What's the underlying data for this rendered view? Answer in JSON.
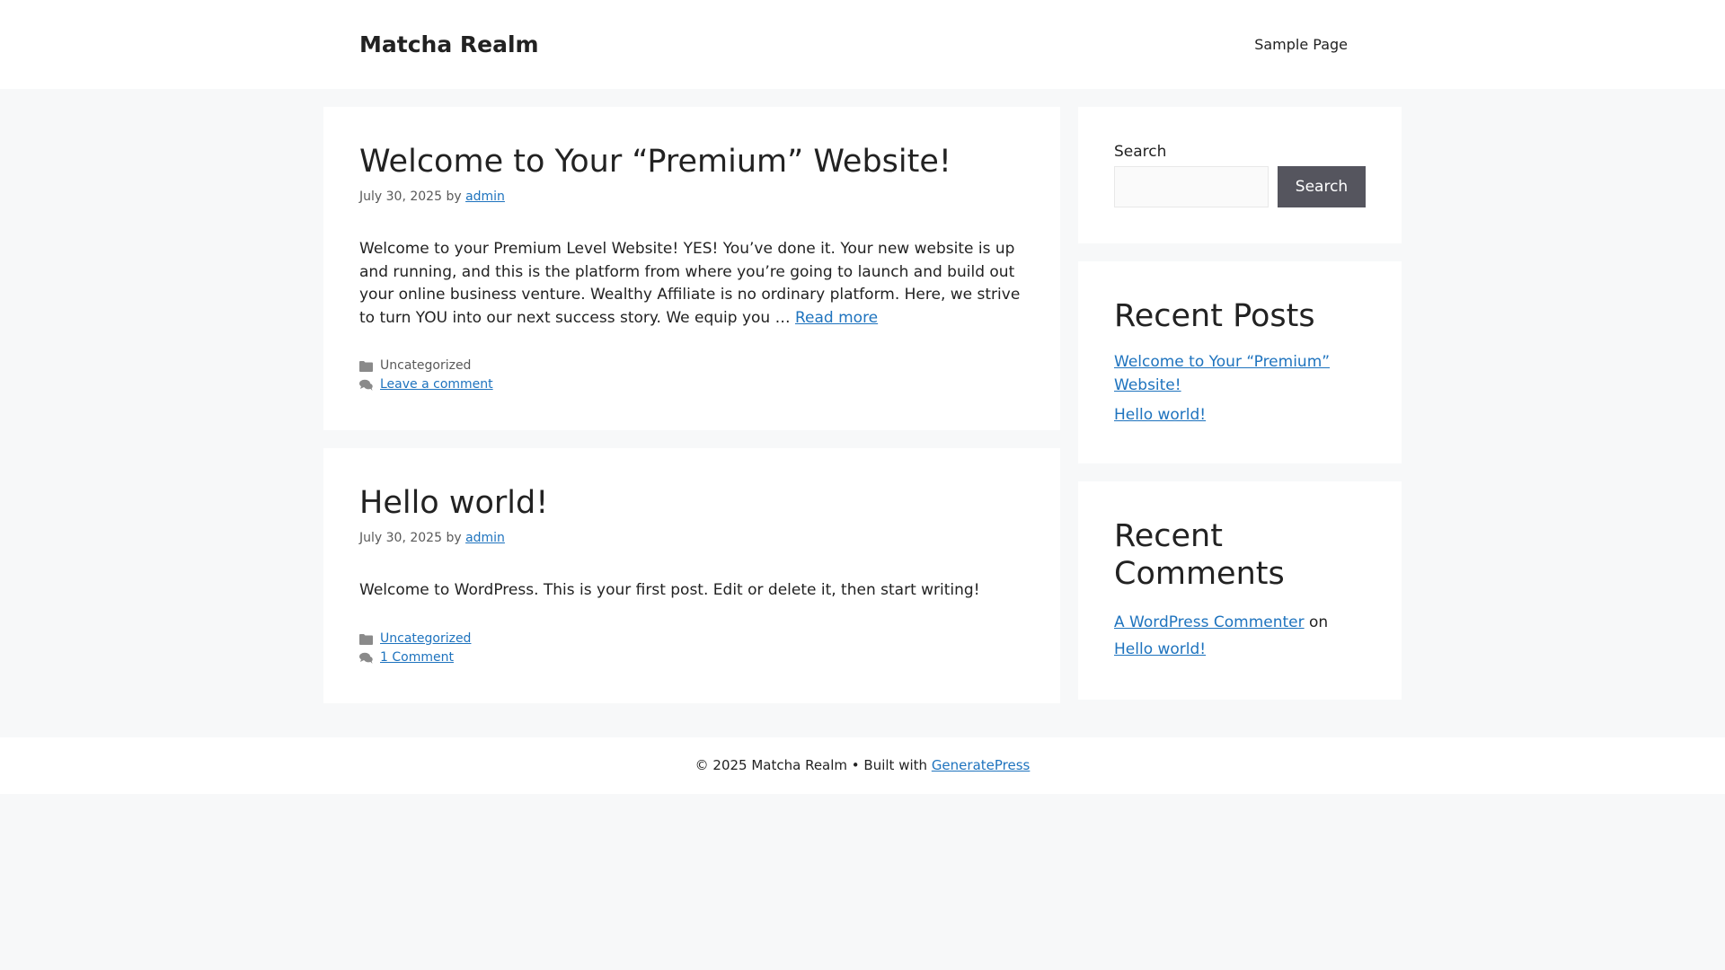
{
  "header": {
    "site_title": "Matcha Realm",
    "nav": [
      {
        "label": "Sample Page"
      }
    ]
  },
  "posts": [
    {
      "title": "Welcome to Your “Premium” Website!",
      "date": "July 30, 2025",
      "by": "by",
      "author": "admin",
      "summary": "Welcome to your Premium Level Website! YES! You’ve done it. Your new website is up and running, and this is the platform from where you’re going to launch and build out your online business venture. Wealthy Affiliate is no ordinary platform. Here, we strive to turn YOU into our next success story. We equip you …",
      "read_more": "Read more",
      "category": "Uncategorized",
      "comments": "Leave a comment"
    },
    {
      "title": "Hello world!",
      "date": "July 30, 2025",
      "by": "by",
      "author": "admin",
      "summary": "Welcome to WordPress. This is your first post. Edit or delete it, then start writing!",
      "category": "Uncategorized",
      "comments": "1 Comment"
    }
  ],
  "sidebar": {
    "search": {
      "label": "Search",
      "value": "",
      "button_label": "Search"
    },
    "recent_posts": {
      "title": "Recent Posts",
      "items": [
        {
          "label": "Welcome to Your “Premium” Website!"
        },
        {
          "label": "Hello world!"
        }
      ]
    },
    "recent_comments": {
      "title": "Recent Comments",
      "author": "A WordPress Commenter",
      "on": "on",
      "post": "Hello world!"
    }
  },
  "footer": {
    "copyright": "© 2025 Matcha Realm • Built with",
    "link": "GeneratePress"
  },
  "icons": {
    "category": "folder-icon",
    "comments": "comments-icon"
  },
  "colors": {
    "link": "#1e73be",
    "button": "#55555e",
    "background": "#f7f8f9"
  }
}
